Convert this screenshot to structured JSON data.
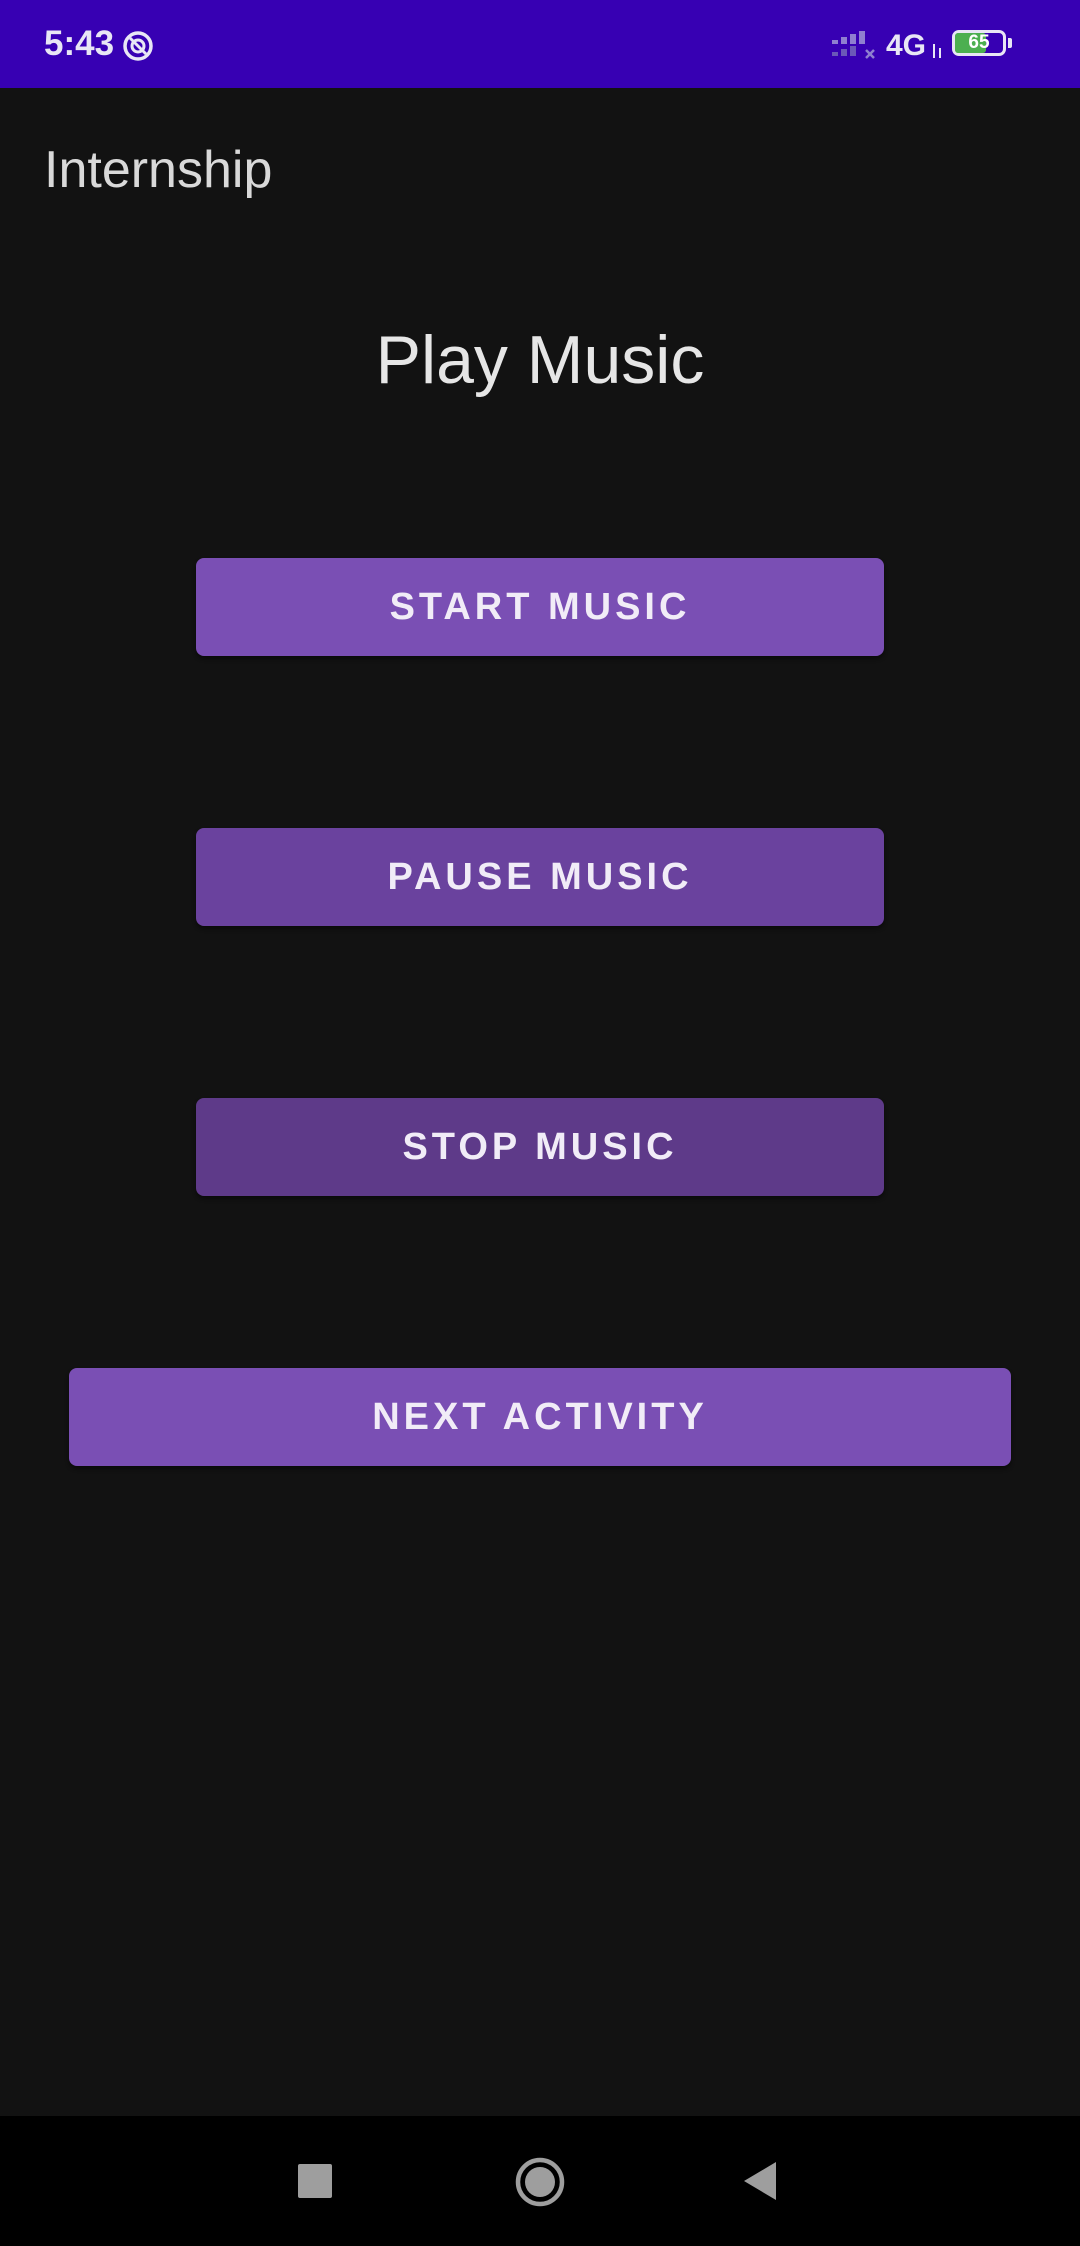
{
  "status_bar": {
    "time": "5:43",
    "network": "4G",
    "battery_percent": "65",
    "battery_level": 0.65,
    "background_color": "#3700b3",
    "icons": [
      "do-not-disturb-icon",
      "signal-icon",
      "data-arrows-icon",
      "battery-icon"
    ]
  },
  "app_bar": {
    "title": "Internship"
  },
  "main": {
    "heading": "Play Music",
    "buttons": {
      "start": "START MUSIC",
      "pause": "PAUSE MUSIC",
      "stop": "STOP MUSIC",
      "next": "NEXT ACTIVITY"
    },
    "colors": {
      "start": "#7a4fb4",
      "pause": "#6a429e",
      "stop": "#5e3a89",
      "next": "#7a4fb4",
      "background": "#121212"
    }
  },
  "nav_bar": {
    "icons": [
      "recents-icon",
      "home-icon",
      "back-icon"
    ]
  }
}
